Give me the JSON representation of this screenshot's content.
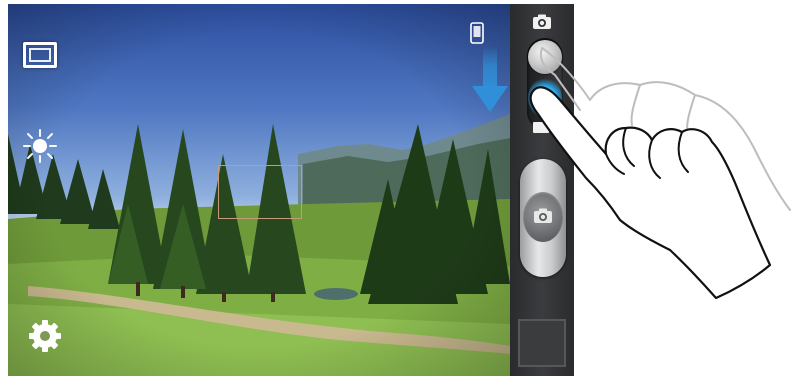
{
  "viewfinder": {
    "icons": [
      "screen-mode-icon",
      "brightness-icon",
      "settings-icon",
      "phone-orientation-icon",
      "swipe-down-arrow-icon"
    ]
  },
  "control_bar": {
    "mode_icons": [
      "camera-icon",
      "video-icon"
    ],
    "active_mode": "camera",
    "shutter_icon": "camera-icon"
  },
  "colors": {
    "control_bar": "#333436",
    "swipe_arrow": "#2f8fd8",
    "mode_glow": "#2aa9e8",
    "focus_frame": "#c79a7a"
  }
}
